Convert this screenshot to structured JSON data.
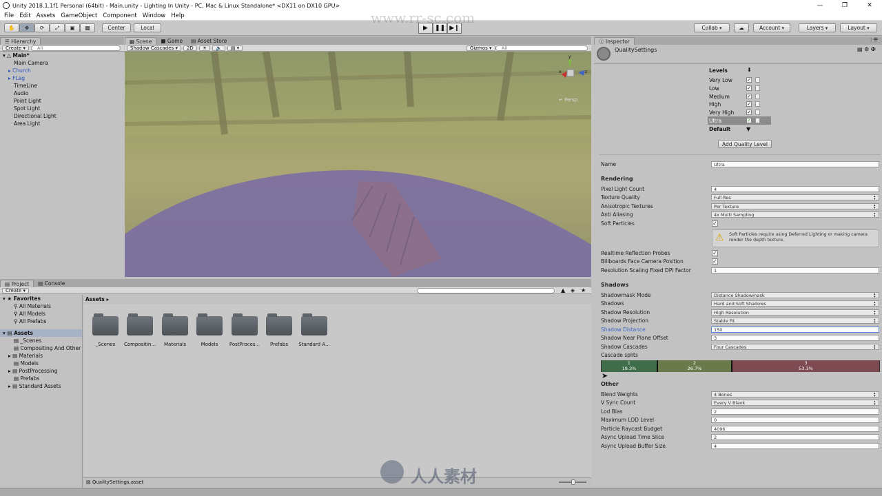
{
  "window": {
    "title": "Unity 2018.1.1f1 Personal (64bit) - Main.unity - Lighting In Unity - PC, Mac & Linux Standalone* <DX11 on DX10 GPU>"
  },
  "menu": [
    "File",
    "Edit",
    "Assets",
    "GameObject",
    "Component",
    "Window",
    "Help"
  ],
  "toolbar": {
    "pivot": "Center",
    "space": "Local",
    "collab": "Collab",
    "account": "Account",
    "layers": "Layers",
    "layout": "Layout"
  },
  "hierarchy": {
    "tab": "Hierarchy",
    "create": "Create",
    "search_placeholder": "All",
    "scene": "Main*",
    "items": [
      "Main Camera",
      "Church",
      "FLag",
      "TimeLine",
      "Audio",
      "Point Light",
      "Spot Light",
      "Directional Light",
      "Area Light"
    ]
  },
  "scene": {
    "tabs": [
      "Scene",
      "Game",
      "Asset Store"
    ],
    "draw_mode": "Shadow Cascades",
    "mode_2d": "2D",
    "gizmos": "Gizmos",
    "search_placeholder": "All",
    "persp": "Persp",
    "axes": {
      "y": "y",
      "x": "x",
      "z": "z"
    }
  },
  "project": {
    "tabs": [
      "Project",
      "Console"
    ],
    "create": "Create",
    "favorites_title": "Favorites",
    "favorites": [
      "All Materials",
      "All Models",
      "All Prefabs"
    ],
    "assets_title": "Assets",
    "assets_tree": [
      "_Scenes",
      "Compositing And Other",
      "Materials",
      "Models",
      "PostProcessing",
      "Prefabs",
      "Standard Assets"
    ],
    "breadcrumb": "Assets",
    "folders": [
      "_Scenes",
      "Compositin...",
      "Materials",
      "Models",
      "PostProces...",
      "Prefabs",
      "Standard A..."
    ],
    "status_file": "QualitySettings.asset"
  },
  "inspector": {
    "tab": "Inspector",
    "title": "QualitySettings",
    "levels_label": "Levels",
    "levels": [
      "Very Low",
      "Low",
      "Medium",
      "High",
      "Very High",
      "Ultra"
    ],
    "default_label": "Default",
    "add_button": "Add Quality Level",
    "name_label": "Name",
    "name_value": "Ultra",
    "rendering": {
      "title": "Rendering",
      "pixel_light_count": {
        "label": "Pixel Light Count",
        "value": "4"
      },
      "texture_quality": {
        "label": "Texture Quality",
        "value": "Full Res"
      },
      "anisotropic": {
        "label": "Anisotropic Textures",
        "value": "Per Texture"
      },
      "anti_aliasing": {
        "label": "Anti Aliasing",
        "value": "4x Multi Sampling"
      },
      "soft_particles": {
        "label": "Soft Particles",
        "checked": true
      },
      "warning": "Soft Particles require using Deferred Lighting or making camera render the depth texture.",
      "reflection_probes": {
        "label": "Realtime Reflection Probes",
        "checked": true
      },
      "billboards": {
        "label": "Billboards Face Camera Position",
        "checked": true
      },
      "dpi": {
        "label": "Resolution Scaling Fixed DPI Factor",
        "value": "1"
      }
    },
    "shadows": {
      "title": "Shadows",
      "shadowmask": {
        "label": "Shadowmask Mode",
        "value": "Distance Shadowmask"
      },
      "shadows": {
        "label": "Shadows",
        "value": "Hard and Soft Shadows"
      },
      "resolution": {
        "label": "Shadow Resolution",
        "value": "High Resolution"
      },
      "projection": {
        "label": "Shadow Projection",
        "value": "Stable Fit"
      },
      "distance": {
        "label": "Shadow Distance",
        "value": "150"
      },
      "near_plane": {
        "label": "Shadow Near Plane Offset",
        "value": "3"
      },
      "cascades": {
        "label": "Shadow Cascades",
        "value": "Four Cascades"
      },
      "cascade_splits_label": "Cascade splits",
      "splits": [
        {
          "index": "1",
          "percent": "19.3%",
          "color": "#3f6c49"
        },
        {
          "index": "2",
          "percent": "26.7%",
          "color": "#6b7a4a"
        },
        {
          "index": "3",
          "percent": "53.3%",
          "color": "#7e4b52"
        }
      ]
    },
    "other": {
      "title": "Other",
      "blend_weights": {
        "label": "Blend Weights",
        "value": "4 Bones"
      },
      "vsync": {
        "label": "V Sync Count",
        "value": "Every V Blank"
      },
      "lod_bias": {
        "label": "Lod Bias",
        "value": "2"
      },
      "max_lod": {
        "label": "Maximum LOD Level",
        "value": "0"
      },
      "raycast": {
        "label": "Particle Raycast Budget",
        "value": "4096"
      },
      "async_time": {
        "label": "Async Upload Time Slice",
        "value": "2"
      },
      "async_buffer": {
        "label": "Async Upload Buffer Size",
        "value": "4"
      }
    }
  },
  "watermark": {
    "top": "www.rr-sc.com",
    "bottom": "人人素材"
  }
}
